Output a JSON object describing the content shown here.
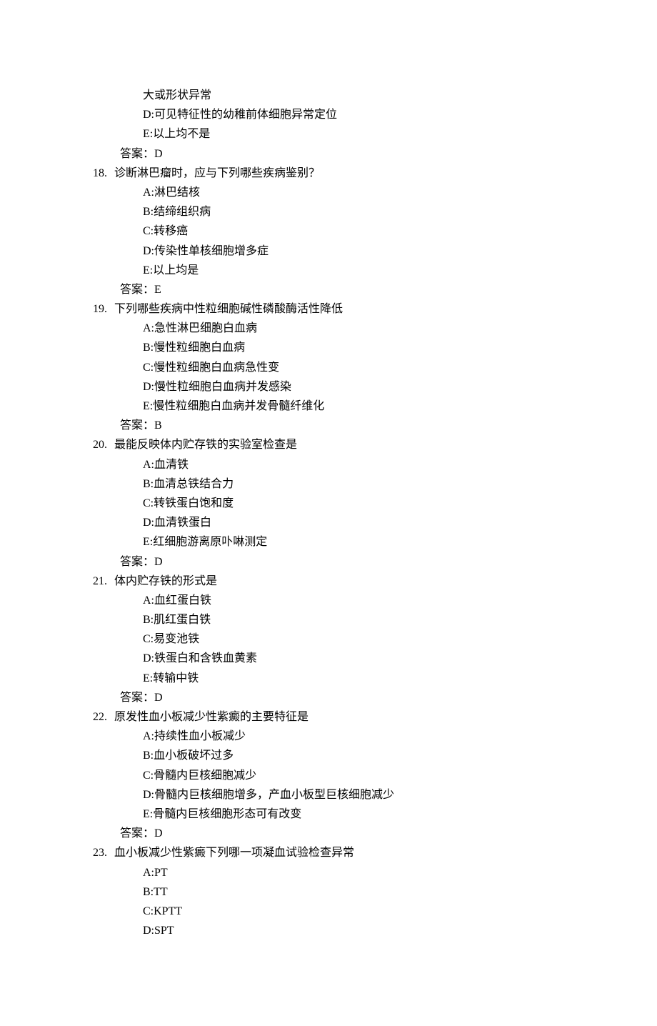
{
  "pre": {
    "cont_c": "大或形状异常",
    "opts": {
      "D": "D:可见特征性的幼稚前体细胞异常定位",
      "E": "E:以上均不是"
    },
    "answer": "答案：D"
  },
  "q18": {
    "num": "18.",
    "stem": "诊断淋巴瘤时，应与下列哪些疾病鉴别？",
    "opts": {
      "A": "A:淋巴结核",
      "B": "B:结缔组织病",
      "C": "C:转移癌",
      "D": "D:传染性单核细胞增多症",
      "E": "E:以上均是"
    },
    "answer": "答案：E"
  },
  "q19": {
    "num": "19.",
    "stem": "下列哪些疾病中性粒细胞碱性磷酸酶活性降低",
    "opts": {
      "A": "A:急性淋巴细胞白血病",
      "B": "B:慢性粒细胞白血病",
      "C": "C:慢性粒细胞白血病急性变",
      "D": "D:慢性粒细胞白血病并发感染",
      "E": "E:慢性粒细胞白血病并发骨髓纤维化"
    },
    "answer": "答案：B"
  },
  "q20": {
    "num": "20.",
    "stem": "最能反映体内贮存铁的实验室检查是",
    "opts": {
      "A": "A:血清铁",
      "B": "B:血清总铁结合力",
      "C": "C:转铁蛋白饱和度",
      "D": "D:血清铁蛋白",
      "E": "E:红细胞游离原卟啉测定"
    },
    "answer": "答案：D"
  },
  "q21": {
    "num": "21.",
    "stem": "体内贮存铁的形式是",
    "opts": {
      "A": "A:血红蛋白铁",
      "B": "B:肌红蛋白铁",
      "C": "C:易变池铁",
      "D": "D:铁蛋白和含铁血黄素",
      "E": "E:转输中铁"
    },
    "answer": "答案：D"
  },
  "q22": {
    "num": "22.",
    "stem": "原发性血小板减少性紫癜的主要特征是",
    "opts": {
      "A": "A:持续性血小板减少",
      "B": "B:血小板破坏过多",
      "C": "C:骨髓内巨核细胞减少",
      "D": "D:骨髓内巨核细胞增多，产血小板型巨核细胞减少",
      "E": "E:骨髓内巨核细胞形态可有改变"
    },
    "answer": "答案：D"
  },
  "q23": {
    "num": "23.",
    "stem": "血小板减少性紫癜下列哪一项凝血试验检查异常",
    "opts": {
      "A": "A:PT",
      "B": "B:TT",
      "C": "C:KPTT",
      "D": "D:SPT"
    }
  }
}
